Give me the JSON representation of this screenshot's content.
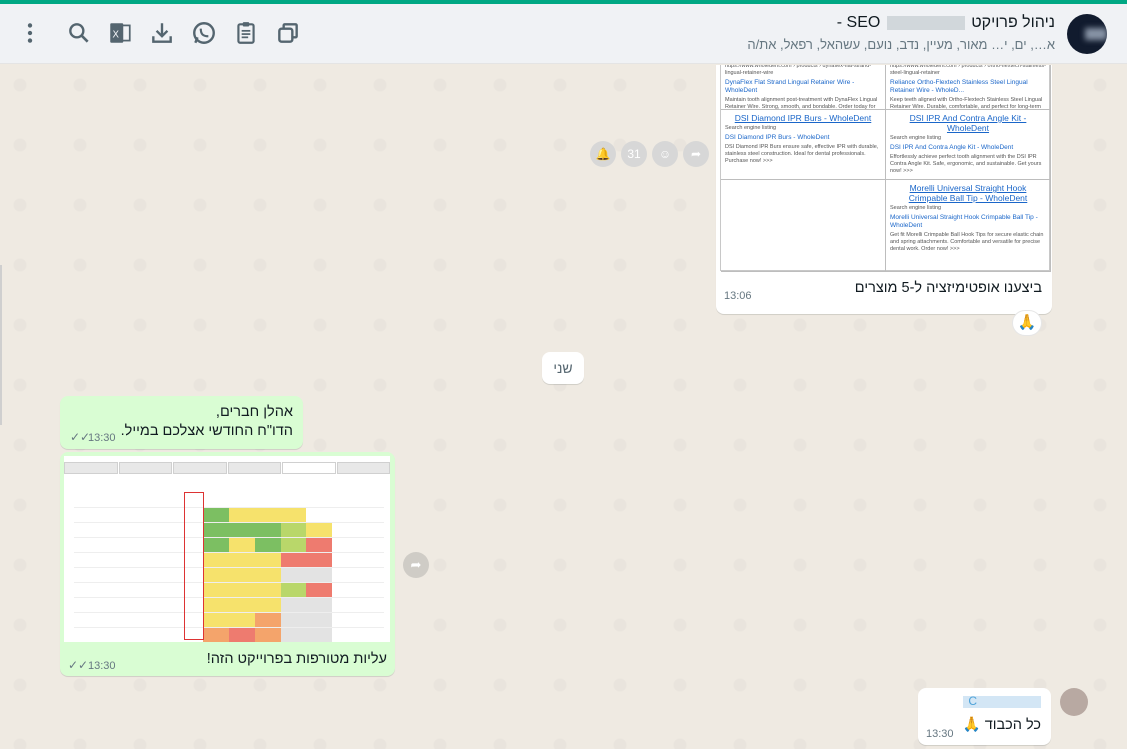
{
  "header": {
    "title_prefix": "SEO - ",
    "title_suffix": "ניהול פרויקט",
    "subtitle": "א…, ים, י… מאור, מעיין, נדב, נועם, עשהאל, רפאל, את/ה",
    "icons": [
      "menu-icon",
      "search-icon",
      "excel-icon",
      "download-icon",
      "whatsapp-icon",
      "clipboard-icon",
      "copy-icon"
    ]
  },
  "colors": {
    "accent": "#00a884",
    "outgoing": "#d9fdd3",
    "incoming": "#ffffff",
    "background": "#efeae2"
  },
  "messages": {
    "m1": {
      "caption": "ביצענו אופטימיזציה ל-5 מוצרים",
      "time": "13:06",
      "reaction": "🙏",
      "products": [
        {
          "title": "",
          "sub": "https://www.wholedent.com › products › dynaflex-flat-strand-lingual-retainer-wire",
          "link": "DynaFlex Flat Strand Lingual Retainer Wire - WholeDent",
          "desc": "Maintain tooth alignment post-treatment with DynaFlex Lingual Retainer Wire. Strong, smooth, and bondable. Order today for lasting stability. Purchase now! >>>"
        },
        {
          "title": "",
          "sub": "https://www.wholedent.com › products › ortho-flextech-stainless-steel-lingual-retainer",
          "link": "Reliance Ortho-Flextech Stainless Steel Lingual Retainer Wire - WholeD...",
          "desc": "Keep teeth aligned with Ortho-Flextech Stainless Steel Lingual Retainer Wire. Durable, comfortable, and perfect for long-term use. Purchase now! >>>"
        },
        {
          "title": "DSI Diamond IPR Burs - WholeDent",
          "sub": "Search engine listing",
          "link": "DSI Diamond IPR Burs - WholeDent",
          "desc": "DSI Diamond IPR Burs ensure safe, effective IPR with durable, stainless steel construction. Ideal for dental professionals. Purchase now! >>>"
        },
        {
          "title": "DSI IPR And Contra Angle Kit - WholeDent",
          "sub": "Search engine listing",
          "link": "DSI IPR And Contra Angle Kit - WholeDent",
          "desc": "Effortlessly achieve perfect tooth alignment with the DSI IPR Contra Angle Kit. Safe, ergonomic, and sustainable. Get yours now! >>>"
        },
        {
          "title": "Morelli Universal Straight Hook Crimpable Ball Tip - WholeDent",
          "sub": "Search engine listing",
          "link": "Morelli Universal Straight Hook Crimpable Ball Tip - WholeDent",
          "desc": "Get fit Morelli Crimpable Ball Hook Tips for secure elastic chain and spring attachments. Comfortable and versatile for precise dental work. Order now! >>>"
        }
      ]
    },
    "date_pill": "שני",
    "m2": {
      "line1": "אהלן חברים,",
      "line2": "הדו\"ח החודשי אצלכם במייל.",
      "time": "13:30"
    },
    "m3": {
      "caption": "עליות מטורפות בפרוייקט הזה!",
      "time": "13:30"
    },
    "m4": {
      "sender": "C",
      "text": "כל הכבוד 🙏",
      "time": "13:30"
    }
  }
}
